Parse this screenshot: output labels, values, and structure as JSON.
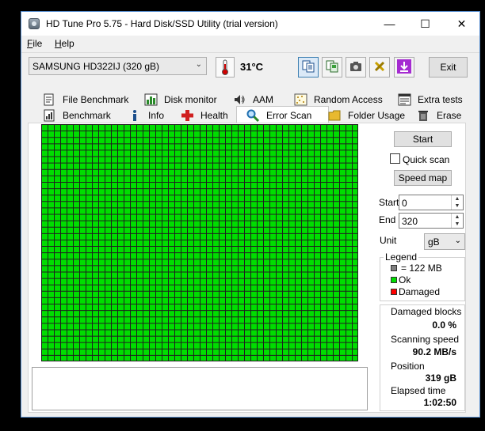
{
  "window": {
    "title": "HD Tune Pro 5.75 - Hard Disk/SSD Utility (trial version)",
    "controls": {
      "minimize": "—",
      "maximize": "☐",
      "close": "✕"
    }
  },
  "menu": {
    "file": {
      "accel": "F",
      "rest": "ile"
    },
    "help": {
      "accel": "H",
      "rest": "elp"
    }
  },
  "toolbar": {
    "drive": "SAMSUNG HD322IJ (320 gB)",
    "temperature": "31°C",
    "exit_label": "Exit",
    "icons": [
      "copy-text-icon",
      "copy-screenshot-icon",
      "camera-icon",
      "tools-icon",
      "download-icon"
    ]
  },
  "tabs": {
    "row1": [
      {
        "label": "File Benchmark",
        "icon": "file-benchmark-icon"
      },
      {
        "label": "Disk monitor",
        "icon": "disk-monitor-icon"
      },
      {
        "label": "AAM",
        "icon": "speaker-icon"
      },
      {
        "label": "Random Access",
        "icon": "random-access-icon"
      },
      {
        "label": "Extra tests",
        "icon": "extra-tests-icon"
      }
    ],
    "row2": [
      {
        "label": "Benchmark",
        "icon": "benchmark-icon"
      },
      {
        "label": "Info",
        "icon": "info-icon"
      },
      {
        "label": "Health",
        "icon": "health-icon"
      },
      {
        "label": "Error Scan",
        "icon": "magnifier-icon",
        "active": true
      },
      {
        "label": "Folder Usage",
        "icon": "folder-icon"
      },
      {
        "label": "Erase",
        "icon": "trash-icon"
      }
    ]
  },
  "scan": {
    "start_button": "Start",
    "quick_scan_label": "Quick scan",
    "quick_scan_checked": false,
    "speed_map_button": "Speed map",
    "start_label": "Start",
    "start_value": "0",
    "end_label": "End",
    "end_value": "320",
    "unit_label": "Unit",
    "unit_value": "gB",
    "grid_status": "all blocks ok",
    "colors": {
      "ok": "#00dd00",
      "damaged": "#ff0000",
      "block": "#808080",
      "grid_line": "#1f1f1f"
    }
  },
  "legend": {
    "title": "Legend",
    "block_size": "= 122 MB",
    "ok": "Ok",
    "damaged": "Damaged"
  },
  "stats": {
    "damaged_blocks_label": "Damaged blocks",
    "damaged_blocks_value": "0.0 %",
    "scanning_speed_label": "Scanning speed",
    "scanning_speed_value": "90.2 MB/s",
    "position_label": "Position",
    "position_value": "319 gB",
    "elapsed_label": "Elapsed time",
    "elapsed_value": "1:02:50"
  }
}
